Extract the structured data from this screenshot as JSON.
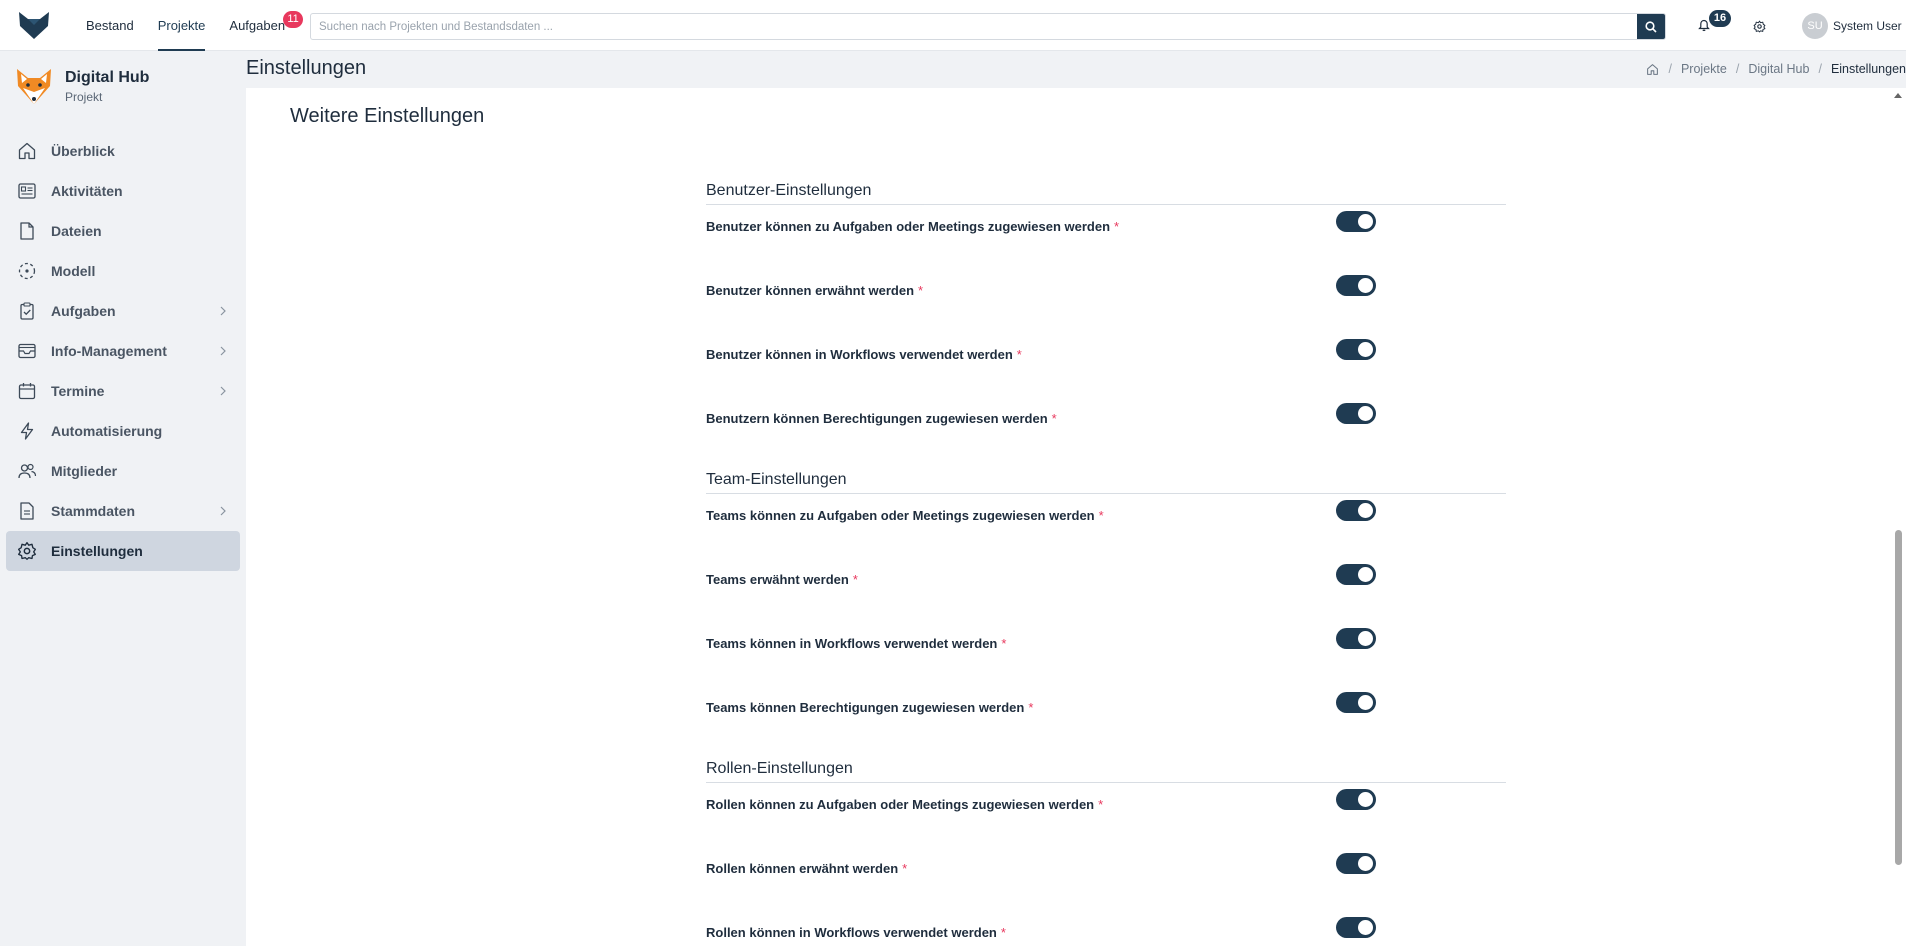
{
  "topbar": {
    "nav": [
      {
        "label": "Bestand"
      },
      {
        "label": "Projekte",
        "active": true
      },
      {
        "label": "Aufgaben",
        "badge": "11"
      }
    ],
    "search_placeholder": "Suchen nach Projekten und Bestandsdaten ...",
    "notifications_count": "16",
    "user_initials": "SU",
    "user_name": "System User"
  },
  "sidebar": {
    "project_name": "Digital Hub",
    "project_sub": "Projekt",
    "items": [
      {
        "label": "Überblick",
        "icon": "home-icon"
      },
      {
        "label": "Aktivitäten",
        "icon": "activity-icon"
      },
      {
        "label": "Dateien",
        "icon": "file-icon"
      },
      {
        "label": "Modell",
        "icon": "model-icon"
      },
      {
        "label": "Aufgaben",
        "icon": "task-icon",
        "expandable": true
      },
      {
        "label": "Info-Management",
        "icon": "inbox-icon",
        "expandable": true
      },
      {
        "label": "Termine",
        "icon": "calendar-icon",
        "expandable": true
      },
      {
        "label": "Automatisierung",
        "icon": "lightning-icon"
      },
      {
        "label": "Mitglieder",
        "icon": "members-icon"
      },
      {
        "label": "Stammdaten",
        "icon": "masterdata-icon",
        "expandable": true
      },
      {
        "label": "Einstellungen",
        "icon": "gear-icon",
        "active": true
      }
    ]
  },
  "header": {
    "title": "Einstellungen",
    "breadcrumb": [
      "Projekte",
      "Digital Hub",
      "Einstellungen"
    ]
  },
  "main": {
    "card_title": "Weitere Einstellungen",
    "sections": [
      {
        "title": "Benutzer-Einstellungen",
        "rows": [
          {
            "label": "Benutzer können zu Aufgaben oder Meetings zugewiesen werden",
            "required": "*",
            "enabled": true
          },
          {
            "label": "Benutzer können erwähnt werden",
            "required": "*",
            "enabled": true
          },
          {
            "label": "Benutzer können in Workflows verwendet werden",
            "required": "*",
            "enabled": true
          },
          {
            "label": "Benutzern können Berechtigungen zugewiesen werden",
            "required": "*",
            "enabled": true
          }
        ]
      },
      {
        "title": "Team-Einstellungen",
        "rows": [
          {
            "label": "Teams können zu Aufgaben oder Meetings zugewiesen werden",
            "required": "*",
            "enabled": true
          },
          {
            "label": "Teams erwähnt werden",
            "required": "*",
            "enabled": true
          },
          {
            "label": "Teams können in Workflows verwendet werden",
            "required": "*",
            "enabled": true
          },
          {
            "label": "Teams können Berechtigungen zugewiesen werden",
            "required": "*",
            "enabled": true
          }
        ]
      },
      {
        "title": "Rollen-Einstellungen",
        "rows": [
          {
            "label": "Rollen können zu Aufgaben oder Meetings zugewiesen werden",
            "required": "*",
            "enabled": true
          },
          {
            "label": "Rollen können erwähnt werden",
            "required": "*",
            "enabled": true
          },
          {
            "label": "Rollen können in Workflows verwendet werden",
            "required": "*",
            "enabled": true
          }
        ]
      }
    ]
  },
  "colors": {
    "accent": "#1f3b52",
    "badge": "#e8385d",
    "active_menu_bg": "#cfd6e0"
  }
}
